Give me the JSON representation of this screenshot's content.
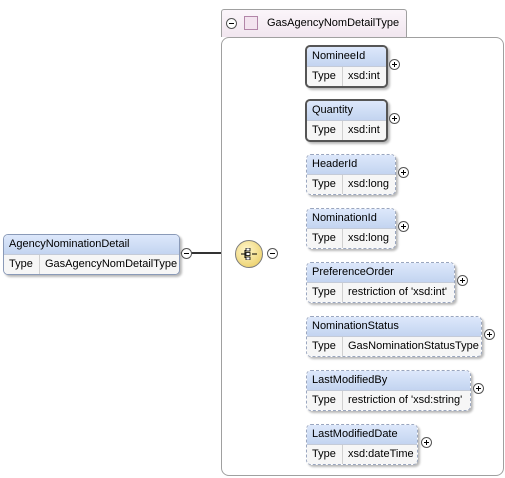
{
  "root": {
    "name": "AgencyNominationDetail",
    "type_key": "Type",
    "type_value": "GasAgencyNomDetailType"
  },
  "complex_type": {
    "title": "GasAgencyNomDetailType"
  },
  "compositor": {
    "icon": "sequence-icon"
  },
  "children": [
    {
      "name": "NomineeId",
      "type_key": "Type",
      "type_value": "xsd:int"
    },
    {
      "name": "Quantity",
      "type_key": "Type",
      "type_value": "xsd:int"
    },
    {
      "name": "HeaderId",
      "type_key": "Type",
      "type_value": "xsd:long"
    },
    {
      "name": "NominationId",
      "type_key": "Type",
      "type_value": "xsd:long"
    },
    {
      "name": "PreferenceOrder",
      "type_key": "Type",
      "type_value": "restriction of 'xsd:int'"
    },
    {
      "name": "NominationStatus",
      "type_key": "Type",
      "type_value": "GasNominationStatusType"
    },
    {
      "name": "LastModifiedBy",
      "type_key": "Type",
      "type_value": "restriction of 'xsd:string'"
    },
    {
      "name": "LastModifiedDate",
      "type_key": "Type",
      "type_value": "xsd:dateTime"
    }
  ],
  "colors": {
    "element_header": "#c9d8f2",
    "compositor": "#e8c957",
    "type_tab": "#f3e3ef"
  }
}
